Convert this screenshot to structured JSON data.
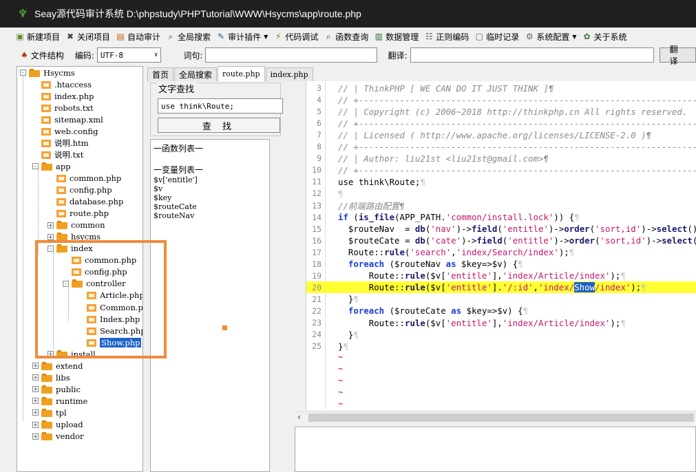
{
  "window": {
    "title": "Seay源代码审计系统  D:\\phpstudy\\PHPTutorial\\WWW\\Hsycms\\app\\route.php"
  },
  "menu": [
    {
      "label": "新建项目",
      "icon": "new-project-icon",
      "dropdown": false
    },
    {
      "label": "关闭项目",
      "icon": "close-project-icon",
      "dropdown": false
    },
    {
      "label": "自动审计",
      "icon": "auto-audit-icon",
      "dropdown": false
    },
    {
      "label": "全局搜索",
      "icon": "global-search-icon",
      "dropdown": false
    },
    {
      "label": "审计插件",
      "icon": "plugin-icon",
      "dropdown": true
    },
    {
      "label": "代码调试",
      "icon": "debug-icon",
      "dropdown": false
    },
    {
      "label": "函数查询",
      "icon": "function-search-icon",
      "dropdown": false
    },
    {
      "label": "数据管理",
      "icon": "data-manage-icon",
      "dropdown": false
    },
    {
      "label": "正则编码",
      "icon": "regex-icon",
      "dropdown": false
    },
    {
      "label": "临时记录",
      "icon": "notes-icon",
      "dropdown": false
    },
    {
      "label": "系统配置",
      "icon": "gear-icon",
      "dropdown": true
    },
    {
      "label": "关于系统",
      "icon": "about-icon",
      "dropdown": false
    }
  ],
  "toolbar": {
    "file_structure_label": "文件结构",
    "encoding_label": "编码:",
    "encoding_value": "UTF-8",
    "word_label": "词句:",
    "word_value": "",
    "translate_label": "翻译:",
    "translate_value": "",
    "translate_button": "翻译"
  },
  "tree": [
    {
      "label": "Hsycms",
      "type": "folder",
      "level": 0,
      "expander": "-"
    },
    {
      "label": ".htaccess",
      "type": "file",
      "level": 1
    },
    {
      "label": "index.php",
      "type": "file",
      "level": 1
    },
    {
      "label": "robots.txt",
      "type": "file",
      "level": 1
    },
    {
      "label": "sitemap.xml",
      "type": "file",
      "level": 1
    },
    {
      "label": "web.config",
      "type": "file",
      "level": 1
    },
    {
      "label": "说明.htm",
      "type": "file",
      "level": 1
    },
    {
      "label": "说明.txt",
      "type": "file",
      "level": 1
    },
    {
      "label": "app",
      "type": "folder",
      "level": 1,
      "expander": "-"
    },
    {
      "label": "common.php",
      "type": "file",
      "level": 2
    },
    {
      "label": "config.php",
      "type": "file",
      "level": 2
    },
    {
      "label": "database.php",
      "type": "file",
      "level": 2
    },
    {
      "label": "route.php",
      "type": "file",
      "level": 2
    },
    {
      "label": "common",
      "type": "folder",
      "level": 2,
      "expander": "+"
    },
    {
      "label": "hsycms",
      "type": "folder",
      "level": 2,
      "expander": "+"
    },
    {
      "label": "index",
      "type": "folder",
      "level": 2,
      "expander": "-"
    },
    {
      "label": "common.php",
      "type": "file",
      "level": 3
    },
    {
      "label": "config.php",
      "type": "file",
      "level": 3
    },
    {
      "label": "controller",
      "type": "folder",
      "level": 3,
      "expander": "-"
    },
    {
      "label": "Article.php",
      "type": "file",
      "level": 4
    },
    {
      "label": "Common.php",
      "type": "file",
      "level": 4
    },
    {
      "label": "Index.php",
      "type": "file",
      "level": 4
    },
    {
      "label": "Search.php",
      "type": "file",
      "level": 4
    },
    {
      "label": "Show.php",
      "type": "file",
      "level": 4,
      "selected": true
    },
    {
      "label": "install",
      "type": "folder",
      "level": 2,
      "expander": "+"
    },
    {
      "label": "extend",
      "type": "folder",
      "level": 1,
      "expander": "+"
    },
    {
      "label": "libs",
      "type": "folder",
      "level": 1,
      "expander": "+"
    },
    {
      "label": "public",
      "type": "folder",
      "level": 1,
      "expander": "+"
    },
    {
      "label": "runtime",
      "type": "folder",
      "level": 1,
      "expander": "+"
    },
    {
      "label": "tpl",
      "type": "folder",
      "level": 1,
      "expander": "+"
    },
    {
      "label": "upload",
      "type": "folder",
      "level": 1,
      "expander": "+"
    },
    {
      "label": "vendor",
      "type": "folder",
      "level": 1,
      "expander": "+"
    }
  ],
  "tabs": [
    "首页",
    "全局搜索",
    "route.php",
    "index.php"
  ],
  "active_tab": "route.php",
  "search_panel": {
    "legend": "文字查找",
    "input_value": "use think\\Route;",
    "button": "查 找"
  },
  "list_panel": {
    "functions_header": "一函数列表一",
    "variables_header": "一变量列表一",
    "variables": [
      "$v['entitle']",
      "$v",
      "$key",
      "$routeCate",
      "$routeNav"
    ]
  },
  "code": [
    {
      "n": "3",
      "text": "// | ThinkPHP [ WE CAN DO IT JUST THINK ]¶"
    },
    {
      "n": "4",
      "text": "// +----------------------------------------------------------------------"
    },
    {
      "n": "5",
      "text": "// | Copyright (c) 2006~2018 http://thinkphp.cn All rights reserved."
    },
    {
      "n": "6",
      "text": "// +----------------------------------------------------------------------"
    },
    {
      "n": "7",
      "text": "// | Licensed ( http://www.apache.org/licenses/LICENSE-2.0 )¶"
    },
    {
      "n": "8",
      "text": "// +----------------------------------------------------------------------"
    },
    {
      "n": "9",
      "text": "// | Author: liu21st <liu21st@gmail.com>¶"
    },
    {
      "n": "10",
      "text": "// +----------------------------------------------------------------------"
    },
    {
      "n": "11",
      "text": "use think\\Route;¶"
    },
    {
      "n": "12",
      "text": "¶"
    },
    {
      "n": "13",
      "text": "//前端路由配置¶"
    },
    {
      "n": "14",
      "text": "if (is_file(APP_PATH.'common/install.lock')) {¶"
    },
    {
      "n": "15",
      "text": "  $routeNav  = db('nav')->field('entitle')->order('sort,id')->select();"
    },
    {
      "n": "16",
      "text": "  $routeCate = db('cate')->field('entitle')->order('sort,id')->select();"
    },
    {
      "n": "17",
      "text": "  Route::rule('search','index/Search/index');¶"
    },
    {
      "n": "18",
      "text": "  foreach ($routeNav as $key=>$v) {¶"
    },
    {
      "n": "19",
      "text": "      Route::rule($v['entitle'],'index/Article/index');¶"
    },
    {
      "n": "20",
      "text": "      Route::rule($v['entitle'].'/:id','index/Show/index');¶"
    },
    {
      "n": "21",
      "text": "  }¶"
    },
    {
      "n": "22",
      "text": "  foreach ($routeCate as $key=>$v) {¶"
    },
    {
      "n": "23",
      "text": "      Route::rule($v['entitle'],'index/Article/index');¶"
    },
    {
      "n": "24",
      "text": "  }¶"
    },
    {
      "n": "25",
      "text": "}¶"
    }
  ],
  "highlighted_line": "20",
  "selected_word": "Show",
  "tilde_rows": [
    "~",
    "~",
    "~",
    "~",
    "~"
  ],
  "colors": {
    "highlight_line": "#ffff33",
    "annotation_box": "#f08b3a",
    "selection": "#1d64c8"
  }
}
